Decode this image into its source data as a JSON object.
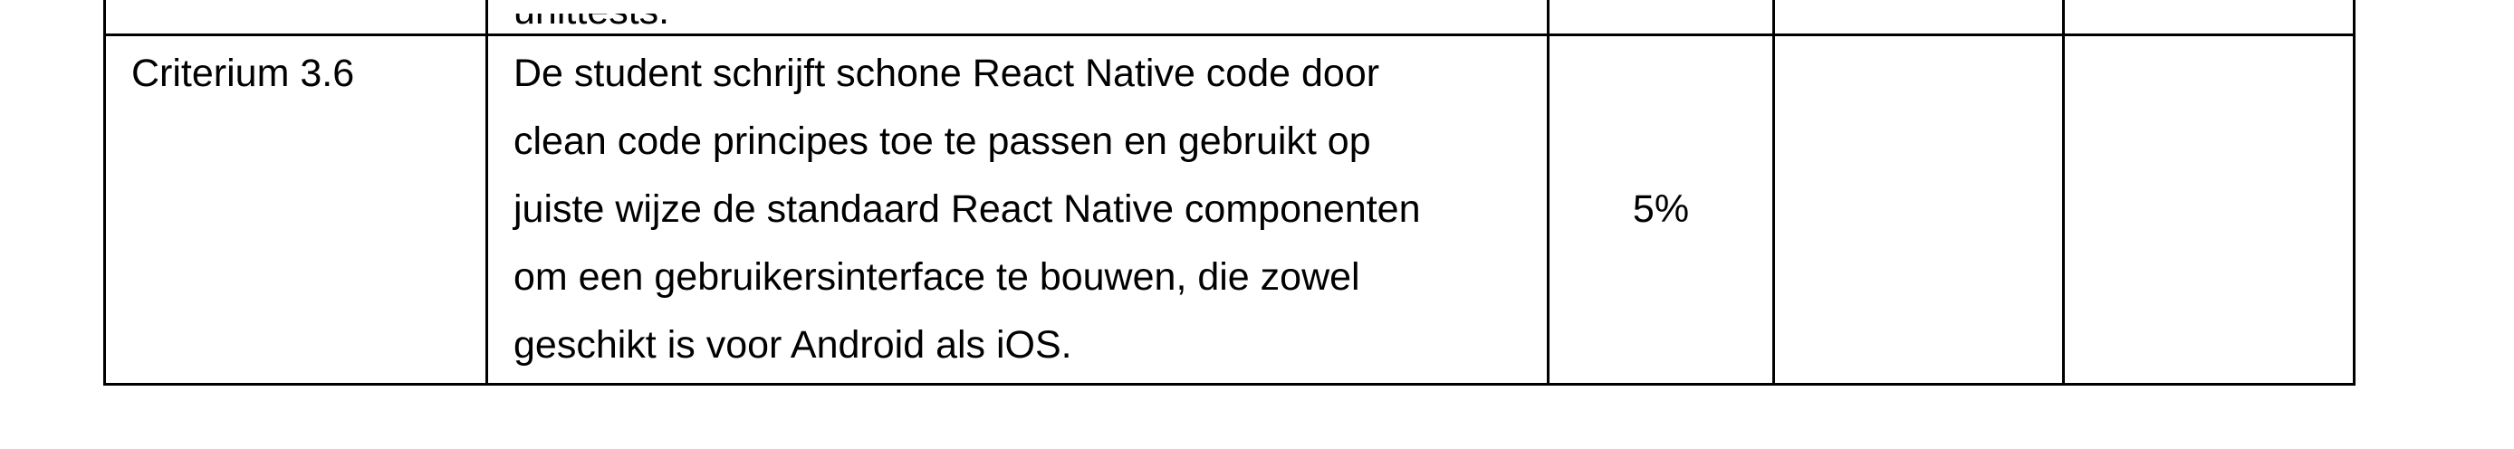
{
  "table": {
    "prev_row": {
      "description_fragment": "unittests."
    },
    "row": {
      "criterion": "Criterium 3.6",
      "description_lines": [
        "De student schrijft schone React Native code door",
        "clean code principes toe te passen en gebruikt op",
        "juiste wijze de standaard React Native componenten",
        "om een gebruikersinterface te bouwen, die zowel",
        "geschikt is voor Android als iOS."
      ],
      "weight": "5%"
    }
  }
}
